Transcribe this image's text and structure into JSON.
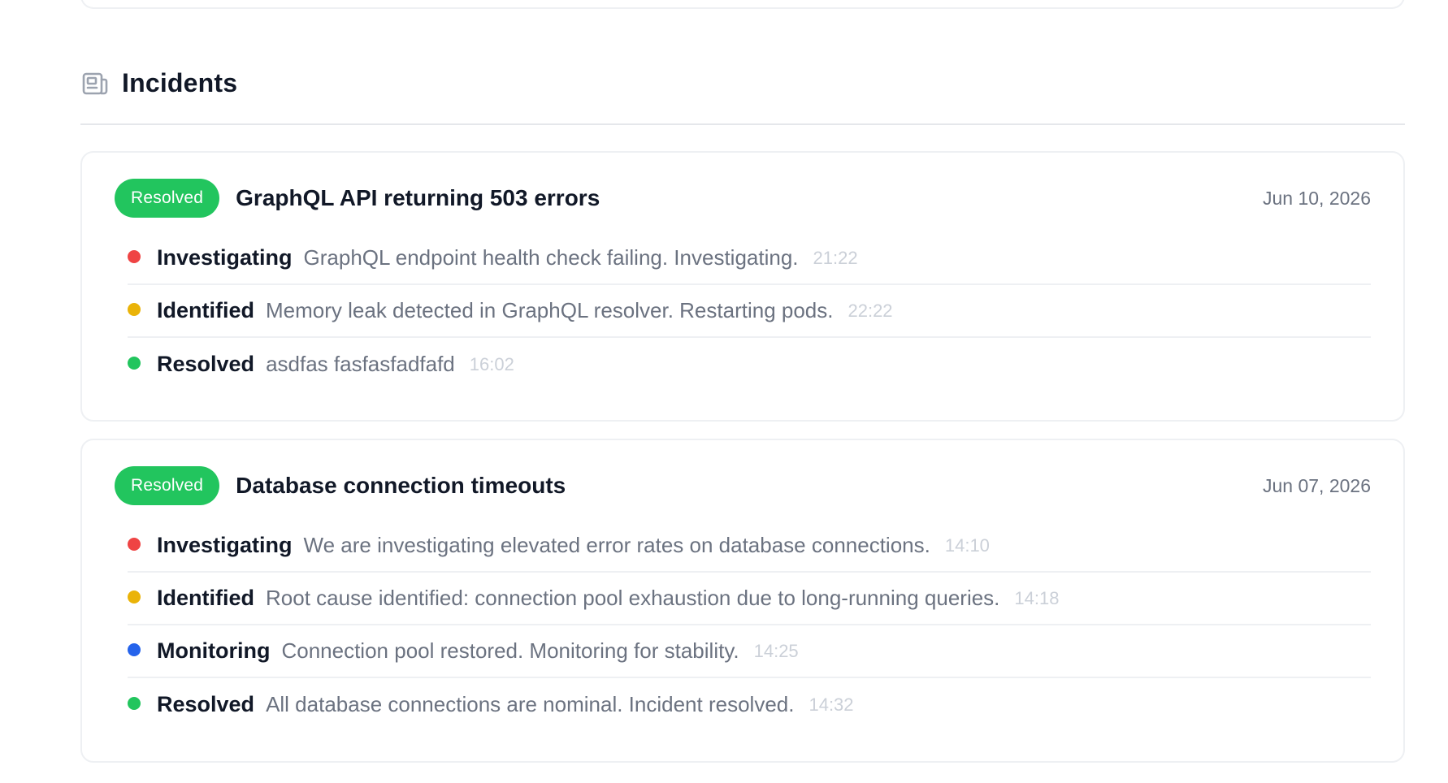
{
  "section": {
    "icon": "newspaper-icon",
    "title": "Incidents"
  },
  "colors": {
    "resolved_badge": "#22c55e",
    "investigating": "#ef4444",
    "identified": "#eab308",
    "monitoring": "#2563eb",
    "resolved": "#22c55e"
  },
  "incidents": [
    {
      "status": "Resolved",
      "title": "GraphQL API returning 503 errors",
      "date": "Jun 10, 2026",
      "updates": [
        {
          "status": "Investigating",
          "message": "GraphQL endpoint health check failing. Investigating.",
          "time": "21:22",
          "color": "#ef4444"
        },
        {
          "status": "Identified",
          "message": "Memory leak detected in GraphQL resolver. Restarting pods.",
          "time": "22:22",
          "color": "#eab308"
        },
        {
          "status": "Resolved",
          "message": "asdfas fasfasfadfafd",
          "time": "16:02",
          "color": "#22c55e"
        }
      ]
    },
    {
      "status": "Resolved",
      "title": "Database connection timeouts",
      "date": "Jun 07, 2026",
      "updates": [
        {
          "status": "Investigating",
          "message": "We are investigating elevated error rates on database connections.",
          "time": "14:10",
          "color": "#ef4444"
        },
        {
          "status": "Identified",
          "message": "Root cause identified: connection pool exhaustion due to long-running queries.",
          "time": "14:18",
          "color": "#eab308"
        },
        {
          "status": "Monitoring",
          "message": "Connection pool restored. Monitoring for stability.",
          "time": "14:25",
          "color": "#2563eb"
        },
        {
          "status": "Resolved",
          "message": "All database connections are nominal. Incident resolved.",
          "time": "14:32",
          "color": "#22c55e"
        }
      ]
    }
  ]
}
